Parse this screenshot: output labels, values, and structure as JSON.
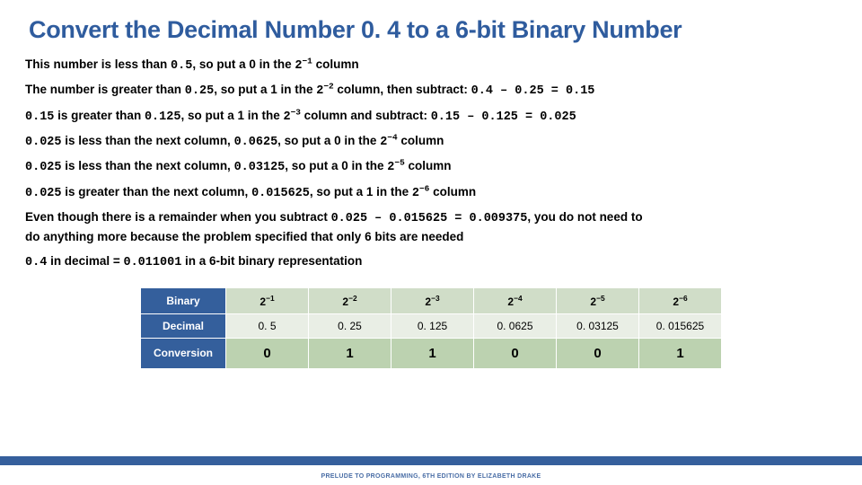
{
  "title": "Convert the Decimal Number 0. 4 to a 6-bit Binary Number",
  "lines": {
    "l1a": "This number is less than ",
    "l1b": "0.5",
    "l1c": ", so put a 0 in the ",
    "l1d_exp": "−1",
    "l1e": " column",
    "l2a": "The number is greater than ",
    "l2b": "0.25",
    "l2c": ", so put a 1 in the ",
    "l2d_exp": "−2",
    "l2e": " column, then subtract: ",
    "l2f": "0.4 – 0.25 = 0.15",
    "l3a": "0.15",
    "l3b": " is greater than ",
    "l3c": "0.125",
    "l3d": ", so put a 1 in the ",
    "l3e_exp": "−3",
    "l3f": " column and subtract: ",
    "l3g": "0.15 – 0.125 = 0.025",
    "l4a": "0.025",
    "l4b": " is less than the next column, ",
    "l4c": "0.0625",
    "l4d": ", so put a 0 in the ",
    "l4e_exp": "−4",
    "l4f": " column",
    "l5a": "0.025",
    "l5b": " is less than the next column, ",
    "l5c": "0.03125",
    "l5d": ", so put a 0 in the ",
    "l5e_exp": "−5",
    "l5f": " column",
    "l6a": "0.025",
    "l6b": " is greater than the next column, ",
    "l6c": "0.015625",
    "l6d": ", so put a 1  in the ",
    "l6e_exp": "−6",
    "l6f": " column",
    "l7a": "Even though there is a remainder when you subtract ",
    "l7b": "0.025 – 0.015625 = 0.009375",
    "l7c": ", you do not need to",
    "l7d": "do anything more because the problem specified that only 6 bits are needed",
    "l8a": "0.4",
    "l8b": " in decimal = ",
    "l8c": "0.011001",
    "l8d": "  in a 6-bit binary representation"
  },
  "table": {
    "headers": [
      "Binary",
      "Decimal",
      "Conversion"
    ],
    "pow_exps": [
      "−1",
      "−2",
      "−3",
      "−4",
      "−5",
      "−6"
    ],
    "decimals": [
      "0. 5",
      "0. 25",
      "0. 125",
      "0. 0625",
      "0. 03125",
      "0. 015625"
    ],
    "conversion": [
      "0",
      "1",
      "1",
      "0",
      "0",
      "1"
    ]
  },
  "footer": "PRELUDE TO PROGRAMMING, 6TH EDITION BY ELIZABETH DRAKE"
}
